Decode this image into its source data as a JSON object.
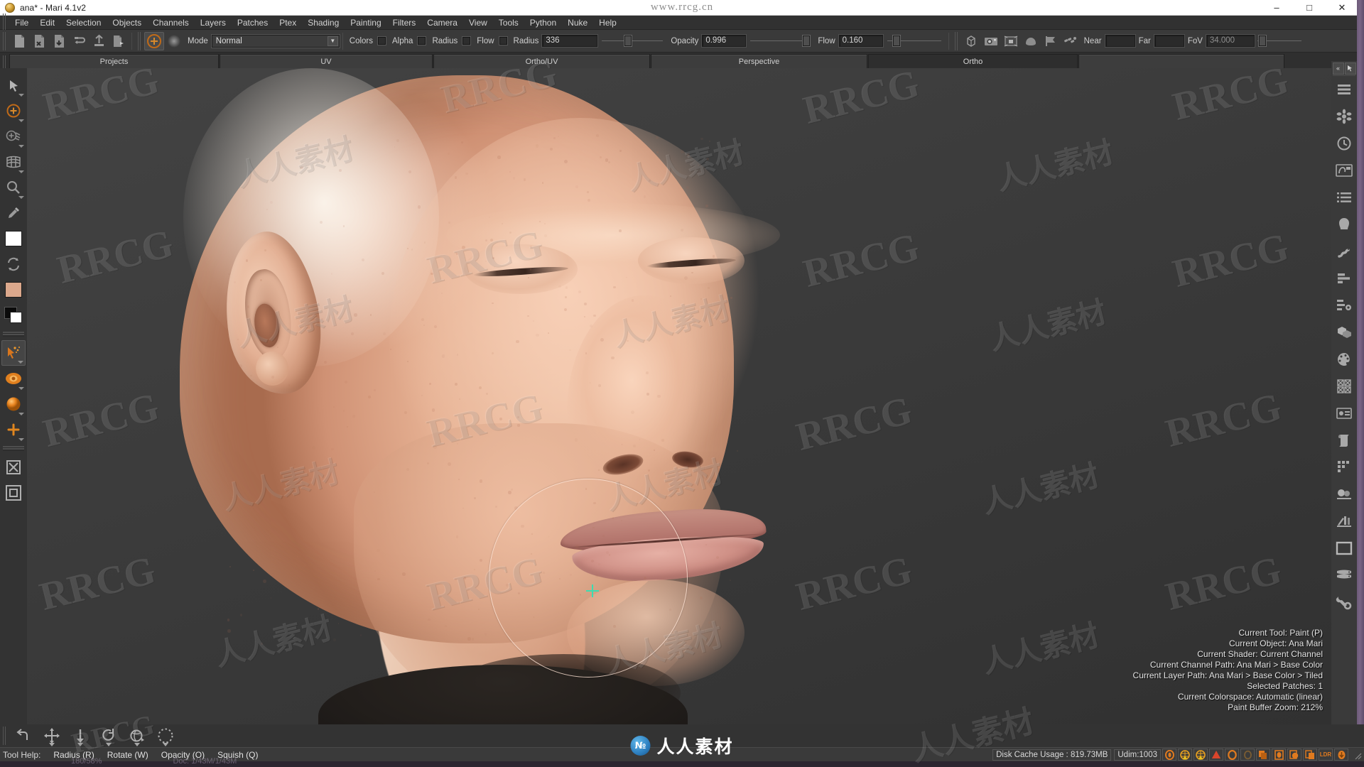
{
  "window": {
    "title": "ana* - Mari 4.1v2",
    "app_icon": "mari-logo-icon",
    "minimize": "–",
    "maximize": "□",
    "close": "✕"
  },
  "menubar": {
    "items": [
      "File",
      "Edit",
      "Selection",
      "Objects",
      "Channels",
      "Layers",
      "Patches",
      "Ptex",
      "Shading",
      "Painting",
      "Filters",
      "Camera",
      "View",
      "Tools",
      "Python",
      "Nuke",
      "Help"
    ]
  },
  "toolbar": {
    "file_buttons": [
      {
        "name": "new-project-icon"
      },
      {
        "name": "close-project-icon"
      },
      {
        "name": "save-project-icon"
      },
      {
        "name": "import-icon"
      },
      {
        "name": "export-icon"
      },
      {
        "name": "export-selected-icon"
      }
    ],
    "paint_buttons": [
      {
        "name": "paint-blob-icon"
      },
      {
        "name": "brush-falloff-icon"
      }
    ],
    "mode_label": "Mode",
    "mode_value": "Normal",
    "toggles": [
      {
        "label": "Colors",
        "checked": false
      },
      {
        "label": "Alpha",
        "checked": false
      },
      {
        "label": "Radius",
        "checked": false
      },
      {
        "label": "Flow",
        "checked": false
      }
    ],
    "radius_label": "Radius",
    "radius_value": "336",
    "opacity_label": "Opacity",
    "opacity_value": "0.996",
    "flow_label": "Flow",
    "flow_value": "0.160",
    "view_buttons": [
      {
        "name": "object-cage-icon"
      },
      {
        "name": "camera-icon"
      },
      {
        "name": "projection-icon"
      },
      {
        "name": "shader-ball-icon"
      },
      {
        "name": "flag-icon"
      },
      {
        "name": "lights-icon"
      }
    ],
    "near_label": "Near",
    "near_value": "",
    "far_label": "Far",
    "far_value": "",
    "fov_label": "FoV",
    "fov_value": "34.000"
  },
  "tabs": [
    {
      "label": "Projects",
      "selected": false
    },
    {
      "label": "UV",
      "selected": false
    },
    {
      "label": "Ortho/UV",
      "selected": false
    },
    {
      "label": "Perspective",
      "selected": false
    },
    {
      "label": "Ortho",
      "selected": true
    },
    {
      "label": "",
      "selected": false
    }
  ],
  "left_tools": [
    {
      "name": "select-arrow-tool",
      "icon": "cursor-arrow-icon",
      "submenu": true,
      "active": false
    },
    {
      "name": "paint-tool",
      "icon": "paint-dot-icon",
      "submenu": true,
      "active": false
    },
    {
      "name": "paint-through-tool",
      "icon": "paint-through-icon",
      "submenu": true,
      "active": false
    },
    {
      "name": "warp-grid-tool",
      "icon": "grid-warp-icon",
      "submenu": true,
      "active": false
    },
    {
      "name": "zoom-tool",
      "icon": "magnifier-icon",
      "submenu": true,
      "active": false
    },
    {
      "name": "color-picker-tool",
      "icon": "eyedropper-icon",
      "submenu": false,
      "active": false
    },
    {
      "name": "white-swatch",
      "icon": "white-swatch-icon",
      "submenu": false,
      "active": false
    },
    {
      "name": "swap-colors",
      "icon": "swap-arrows-icon",
      "submenu": false,
      "active": false
    },
    {
      "name": "foreground-color-swatch",
      "icon": "skin-color-swatch-icon",
      "submenu": false,
      "active": false
    },
    {
      "name": "background-color-swatch",
      "icon": "black-white-swatch-icon",
      "submenu": false,
      "active": false
    },
    {
      "name": "paint-buffer-tool",
      "icon": "orange-splash-icon",
      "submenu": true,
      "active": true
    },
    {
      "name": "visibility-tool",
      "icon": "orange-eye-icon",
      "submenu": true,
      "active": false
    },
    {
      "name": "sphere-tool",
      "icon": "orange-sphere-icon",
      "submenu": true,
      "active": false
    },
    {
      "name": "add-tool",
      "icon": "orange-plus-icon",
      "submenu": true,
      "active": false
    },
    {
      "name": "bake-tool",
      "icon": "bake-box-icon",
      "submenu": false,
      "active": false
    },
    {
      "name": "frame-tool",
      "icon": "frame-square-icon",
      "submenu": false,
      "active": false
    }
  ],
  "right_palette": {
    "collapse": "«",
    "pin": "cursor-pin-icon",
    "items": [
      {
        "name": "palette-layers",
        "icon": "hamburger-lines-icon"
      },
      {
        "name": "palette-node-graph",
        "icon": "asterisk-star-icon"
      },
      {
        "name": "palette-history",
        "icon": "clock-history-icon"
      },
      {
        "name": "palette-image-manager",
        "icon": "image-manager-icon"
      },
      {
        "name": "palette-channels",
        "icon": "list-rows-icon"
      },
      {
        "name": "palette-shelf",
        "icon": "shell-icon"
      },
      {
        "name": "palette-python",
        "icon": "snake-icon"
      },
      {
        "name": "palette-projects",
        "icon": "bars-chart-icon"
      },
      {
        "name": "palette-settings-list",
        "icon": "list-gear-icon"
      },
      {
        "name": "palette-objects",
        "icon": "cubes-icon"
      },
      {
        "name": "palette-color",
        "icon": "palette-paint-icon"
      },
      {
        "name": "palette-patches",
        "icon": "checker-patches-icon"
      },
      {
        "name": "palette-info",
        "icon": "info-card-icon"
      },
      {
        "name": "palette-scroll",
        "icon": "scroll-paper-icon"
      },
      {
        "name": "palette-pixels",
        "icon": "pixel-blocks-icon"
      },
      {
        "name": "palette-lights",
        "icon": "two-spheres-icon"
      },
      {
        "name": "palette-shaders",
        "icon": "shader-tools-icon"
      },
      {
        "name": "palette-canvas",
        "icon": "empty-frame-icon"
      },
      {
        "name": "palette-stack",
        "icon": "stacked-layers-icon"
      },
      {
        "name": "palette-preferences",
        "icon": "wrench-gear-icon"
      }
    ]
  },
  "viewport": {
    "model_name": "ana-head-3d-model",
    "brush_cursor": "brush-circle-cursor",
    "hud_lines": [
      "Current Tool: Paint (P)",
      "Current Object: Ana Mari",
      "Current Shader: Current Channel",
      "Current Channel Path: Ana Mari > Base Color",
      "Current Layer Path: Ana Mari > Base Color > Tiled",
      "Selected Patches: 1",
      "Current Colorspace: Automatic (linear)",
      "Paint Buffer Zoom: 212%"
    ]
  },
  "bottom_tools": [
    {
      "name": "undo-stroke-button",
      "icon": "undo-arrow-icon",
      "submenu": false
    },
    {
      "name": "move-buffer-button",
      "icon": "move-cross-icon",
      "submenu": true
    },
    {
      "name": "bake-down-button",
      "icon": "down-arrow-icon",
      "submenu": true
    },
    {
      "name": "rotate-buffer-button",
      "icon": "rotate-circle-icon",
      "submenu": true
    },
    {
      "name": "squish-buffer-button",
      "icon": "squish-icon",
      "submenu": true
    },
    {
      "name": "radius-button",
      "icon": "dotted-circle-icon",
      "submenu": true
    }
  ],
  "statusbar": {
    "tool_help_label": "Tool Help:",
    "shortcuts": [
      "Radius (R)",
      "Rotate (W)",
      "Opacity (O)",
      "Squish (Q)"
    ],
    "disk_cache": "Disk Cache Usage : 819.73MB",
    "udim": "Udim:1003",
    "indicators": [
      {
        "name": "render-status-icon",
        "color": "#e07a1f"
      },
      {
        "name": "warning-bake-icon",
        "color": "#e8a020"
      },
      {
        "name": "warning-bake-2-icon",
        "color": "#e8a020"
      },
      {
        "name": "alert-triangle-icon",
        "color": "#d9452b"
      },
      {
        "name": "unbaked-icon",
        "color": "#e07a1f"
      },
      {
        "name": "dim-status-icon",
        "color": "#7a5c33"
      },
      {
        "name": "layers-status-icon",
        "color": "#e07a1f"
      },
      {
        "name": "patch-status-icon",
        "color": "#e07a1f"
      },
      {
        "name": "paint-buffer-status-icon",
        "color": "#e07a1f"
      },
      {
        "name": "copy-status-icon",
        "color": "#e07a1f"
      },
      {
        "name": "ldr-status-icon",
        "color": "#e07a1f",
        "label": "LDR"
      },
      {
        "name": "download-status-icon",
        "color": "#e07a1f"
      }
    ],
    "resize_grip": "resize-grip-icon"
  },
  "hidden_row": {
    "zoom": "180/58%",
    "doc": "Doc: 1/43M/1/43M"
  },
  "watermarks": {
    "site_top": "www.rrcg.cn",
    "logo_text": "人人素材",
    "logo_badge": "№",
    "tiles": [
      "RRCG",
      "人人素材"
    ]
  }
}
